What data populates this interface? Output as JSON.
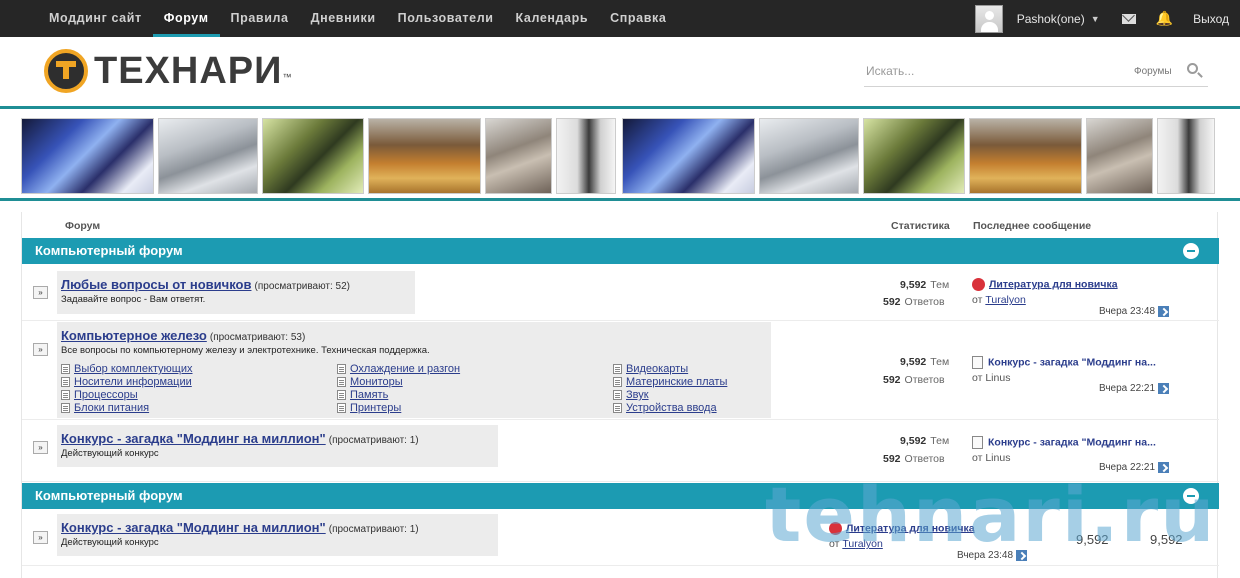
{
  "nav": {
    "items": [
      {
        "label": "Моддинг сайт",
        "active": false
      },
      {
        "label": "Форум",
        "active": true
      },
      {
        "label": "Правила",
        "active": false
      },
      {
        "label": "Дневники",
        "active": false
      },
      {
        "label": "Пользователи",
        "active": false
      },
      {
        "label": "Календарь",
        "active": false
      },
      {
        "label": "Справка",
        "active": false
      }
    ],
    "username": "Pashok(one)",
    "logout": "Выход"
  },
  "header": {
    "logo_text": "ТЕХНАРИ",
    "logo_tm": "™",
    "search_placeholder": "Искать...",
    "search_scope": "Форумы"
  },
  "banner": {
    "images": [
      "blue-lit case mod",
      "exploded case parts",
      "metal gatling-style mod",
      "steampunk wooden mod",
      "metal dome mod",
      "white PC case",
      "blue-lit case mod",
      "exploded case parts",
      "metal gatling-style mod",
      "steampunk wooden mod",
      "metal dome mod",
      "white PC case"
    ]
  },
  "table": {
    "col_forum": "Форум",
    "col_stats": "Статистика",
    "col_last": "Последнее сообщение"
  },
  "categories": [
    {
      "title": "Компьютерный форум"
    },
    {
      "title": "Компьютерный форум"
    }
  ],
  "forums": [
    {
      "title": "Любые вопросы от новичков",
      "viewing": "(просматривают: 52)",
      "desc": "Задавайте вопрос - Вам ответят.",
      "threads": "9,592",
      "threads_label": "Тем",
      "posts": "592",
      "posts_label": "Ответов",
      "last_title": "Литература для новичка",
      "last_by": "от",
      "last_author": "Turalyon",
      "last_date": "Вчера 23:48"
    },
    {
      "title": "Компьютерное железо",
      "viewing": "(просматривают: 53)",
      "desc": "Все вопросы по компьютерному железу и электротехнике. Техническая поддержка.",
      "subforums": [
        "Выбор комплектующих",
        "Охлаждение и разгон",
        "Видеокарты",
        "Носители информации",
        "Мониторы",
        "Материнские платы",
        "Процессоры",
        "Память",
        "Звук",
        "Блоки питания",
        "Принтеры",
        "Устройства ввода"
      ],
      "threads": "9,592",
      "threads_label": "Тем",
      "posts": "592",
      "posts_label": "Ответов",
      "last_title": "Конкурс - загадка \"Моддинг на...",
      "last_by": "от",
      "last_author": "Linus",
      "last_date": "Вчера 22:21"
    },
    {
      "title": "Конкурс - загадка \"Моддинг на миллион\"",
      "viewing": "(просматривают: 1)",
      "desc": "Действующий конкурс",
      "threads": "9,592",
      "threads_label": "Тем",
      "posts": "592",
      "posts_label": "Ответов",
      "last_title": "Конкурс - загадка \"Моддинг на...",
      "last_by": "от",
      "last_author": "Linus",
      "last_date": "Вчера 22:21"
    },
    {
      "title": "Конкурс - загадка \"Моддинг на миллион\"",
      "viewing": "(просматривают: 1)",
      "desc": "Действующий конкурс",
      "threads": "9,592",
      "posts": "9,592",
      "last_title": "Литература для новичка",
      "last_by": "от",
      "last_author": "Turalyon",
      "last_date": "Вчера 23:48"
    }
  ],
  "watermark": "tehnari.ru"
}
